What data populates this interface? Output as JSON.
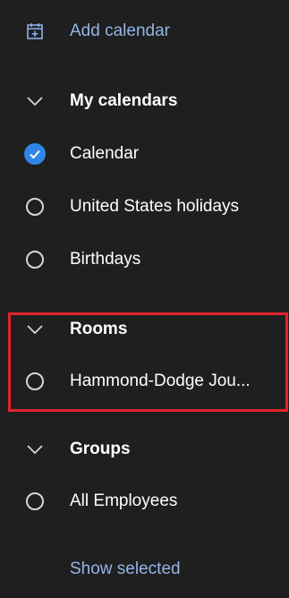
{
  "add_calendar": {
    "label": "Add calendar",
    "icon": "calendar-add-icon"
  },
  "my_calendars": {
    "header": "My calendars",
    "items": [
      {
        "label": "Calendar",
        "checked": true
      },
      {
        "label": "United States holidays",
        "checked": false
      },
      {
        "label": "Birthdays",
        "checked": false
      }
    ]
  },
  "rooms": {
    "header": "Rooms",
    "items": [
      {
        "label": "Hammond-Dodge Jou...",
        "checked": false
      }
    ]
  },
  "groups": {
    "header": "Groups",
    "items": [
      {
        "label": "All Employees",
        "checked": false
      }
    ]
  },
  "show_selected": {
    "label": "Show selected"
  },
  "colors": {
    "background": "#1f1f1f",
    "accent": "#2f86e6",
    "link": "#93b4e6",
    "highlight": "#e0232c"
  }
}
